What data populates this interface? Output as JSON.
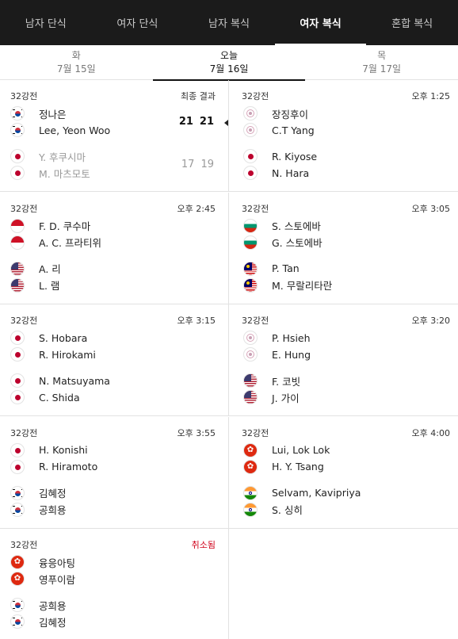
{
  "categories": [
    {
      "label": "남자 단식",
      "active": false
    },
    {
      "label": "여자 단식",
      "active": false
    },
    {
      "label": "남자 복식",
      "active": false
    },
    {
      "label": "여자 복식",
      "active": true
    },
    {
      "label": "혼합 복식",
      "active": false
    }
  ],
  "dates": [
    {
      "dow": "화",
      "date": "7월 15일",
      "active": false
    },
    {
      "dow": "오늘",
      "date": "7월 16일",
      "active": true
    },
    {
      "dow": "목",
      "date": "7월 17일",
      "active": false
    }
  ],
  "matches": [
    {
      "round": "32강전",
      "status": "최종 결과",
      "cancelled": false,
      "team1": {
        "players": [
          {
            "name": "정나은",
            "flag": "kr"
          },
          {
            "name": "Lee, Yeon Woo",
            "flag": "kr"
          }
        ],
        "scores": [
          "21",
          "21"
        ],
        "winner": true
      },
      "team2": {
        "players": [
          {
            "name": "Y. 후쿠시마",
            "flag": "jp"
          },
          {
            "name": "M. 마츠모토",
            "flag": "jp"
          }
        ],
        "scores": [
          "17",
          "19"
        ],
        "winner": false
      }
    },
    {
      "round": "32강전",
      "status": "오후 1:25",
      "cancelled": false,
      "team1": {
        "players": [
          {
            "name": "장징후이",
            "flag": "tpe"
          },
          {
            "name": "C.T Yang",
            "flag": "tpe"
          }
        ],
        "scores": [],
        "winner": false
      },
      "team2": {
        "players": [
          {
            "name": "R. Kiyose",
            "flag": "jp"
          },
          {
            "name": "N. Hara",
            "flag": "jp"
          }
        ],
        "scores": [],
        "winner": false
      }
    },
    {
      "round": "32강전",
      "status": "오후 2:45",
      "cancelled": false,
      "team1": {
        "players": [
          {
            "name": "F. D. 쿠수마",
            "flag": "id"
          },
          {
            "name": "A. C. 프라티위",
            "flag": "id"
          }
        ],
        "scores": [],
        "winner": false
      },
      "team2": {
        "players": [
          {
            "name": "A. 리",
            "flag": "us"
          },
          {
            "name": "L. 램",
            "flag": "us"
          }
        ],
        "scores": [],
        "winner": false
      }
    },
    {
      "round": "32강전",
      "status": "오후 3:05",
      "cancelled": false,
      "team1": {
        "players": [
          {
            "name": "S. 스토에바",
            "flag": "bg"
          },
          {
            "name": "G. 스토에바",
            "flag": "bg"
          }
        ],
        "scores": [],
        "winner": false
      },
      "team2": {
        "players": [
          {
            "name": "P. Tan",
            "flag": "my"
          },
          {
            "name": "M. 무랄리타란",
            "flag": "my"
          }
        ],
        "scores": [],
        "winner": false
      }
    },
    {
      "round": "32강전",
      "status": "오후 3:15",
      "cancelled": false,
      "team1": {
        "players": [
          {
            "name": "S. Hobara",
            "flag": "jp"
          },
          {
            "name": "R. Hirokami",
            "flag": "jp"
          }
        ],
        "scores": [],
        "winner": false
      },
      "team2": {
        "players": [
          {
            "name": "N. Matsuyama",
            "flag": "jp"
          },
          {
            "name": "C. Shida",
            "flag": "jp"
          }
        ],
        "scores": [],
        "winner": false
      }
    },
    {
      "round": "32강전",
      "status": "오후 3:20",
      "cancelled": false,
      "team1": {
        "players": [
          {
            "name": "P. Hsieh",
            "flag": "tpe"
          },
          {
            "name": "E. Hung",
            "flag": "tpe"
          }
        ],
        "scores": [],
        "winner": false
      },
      "team2": {
        "players": [
          {
            "name": "F. 코빗",
            "flag": "us"
          },
          {
            "name": "J. 가이",
            "flag": "us"
          }
        ],
        "scores": [],
        "winner": false
      }
    },
    {
      "round": "32강전",
      "status": "오후 3:55",
      "cancelled": false,
      "team1": {
        "players": [
          {
            "name": "H. Konishi",
            "flag": "jp"
          },
          {
            "name": "R. Hiramoto",
            "flag": "jp"
          }
        ],
        "scores": [],
        "winner": false
      },
      "team2": {
        "players": [
          {
            "name": "김혜정",
            "flag": "kr"
          },
          {
            "name": "공희용",
            "flag": "kr"
          }
        ],
        "scores": [],
        "winner": false
      }
    },
    {
      "round": "32강전",
      "status": "오후 4:00",
      "cancelled": false,
      "team1": {
        "players": [
          {
            "name": "Lui, Lok Lok",
            "flag": "hk"
          },
          {
            "name": "H. Y. Tsang",
            "flag": "hk"
          }
        ],
        "scores": [],
        "winner": false
      },
      "team2": {
        "players": [
          {
            "name": "Selvam, Kavipriya",
            "flag": "in"
          },
          {
            "name": "S. 싱히",
            "flag": "in"
          }
        ],
        "scores": [],
        "winner": false
      }
    },
    {
      "round": "32강전",
      "status": "취소됨",
      "cancelled": true,
      "team1": {
        "players": [
          {
            "name": "융응아팅",
            "flag": "hk"
          },
          {
            "name": "영푸이람",
            "flag": "hk"
          }
        ],
        "scores": [],
        "winner": false
      },
      "team2": {
        "players": [
          {
            "name": "공희용",
            "flag": "kr"
          },
          {
            "name": "김혜정",
            "flag": "kr"
          }
        ],
        "scores": [],
        "winner": false
      }
    }
  ]
}
